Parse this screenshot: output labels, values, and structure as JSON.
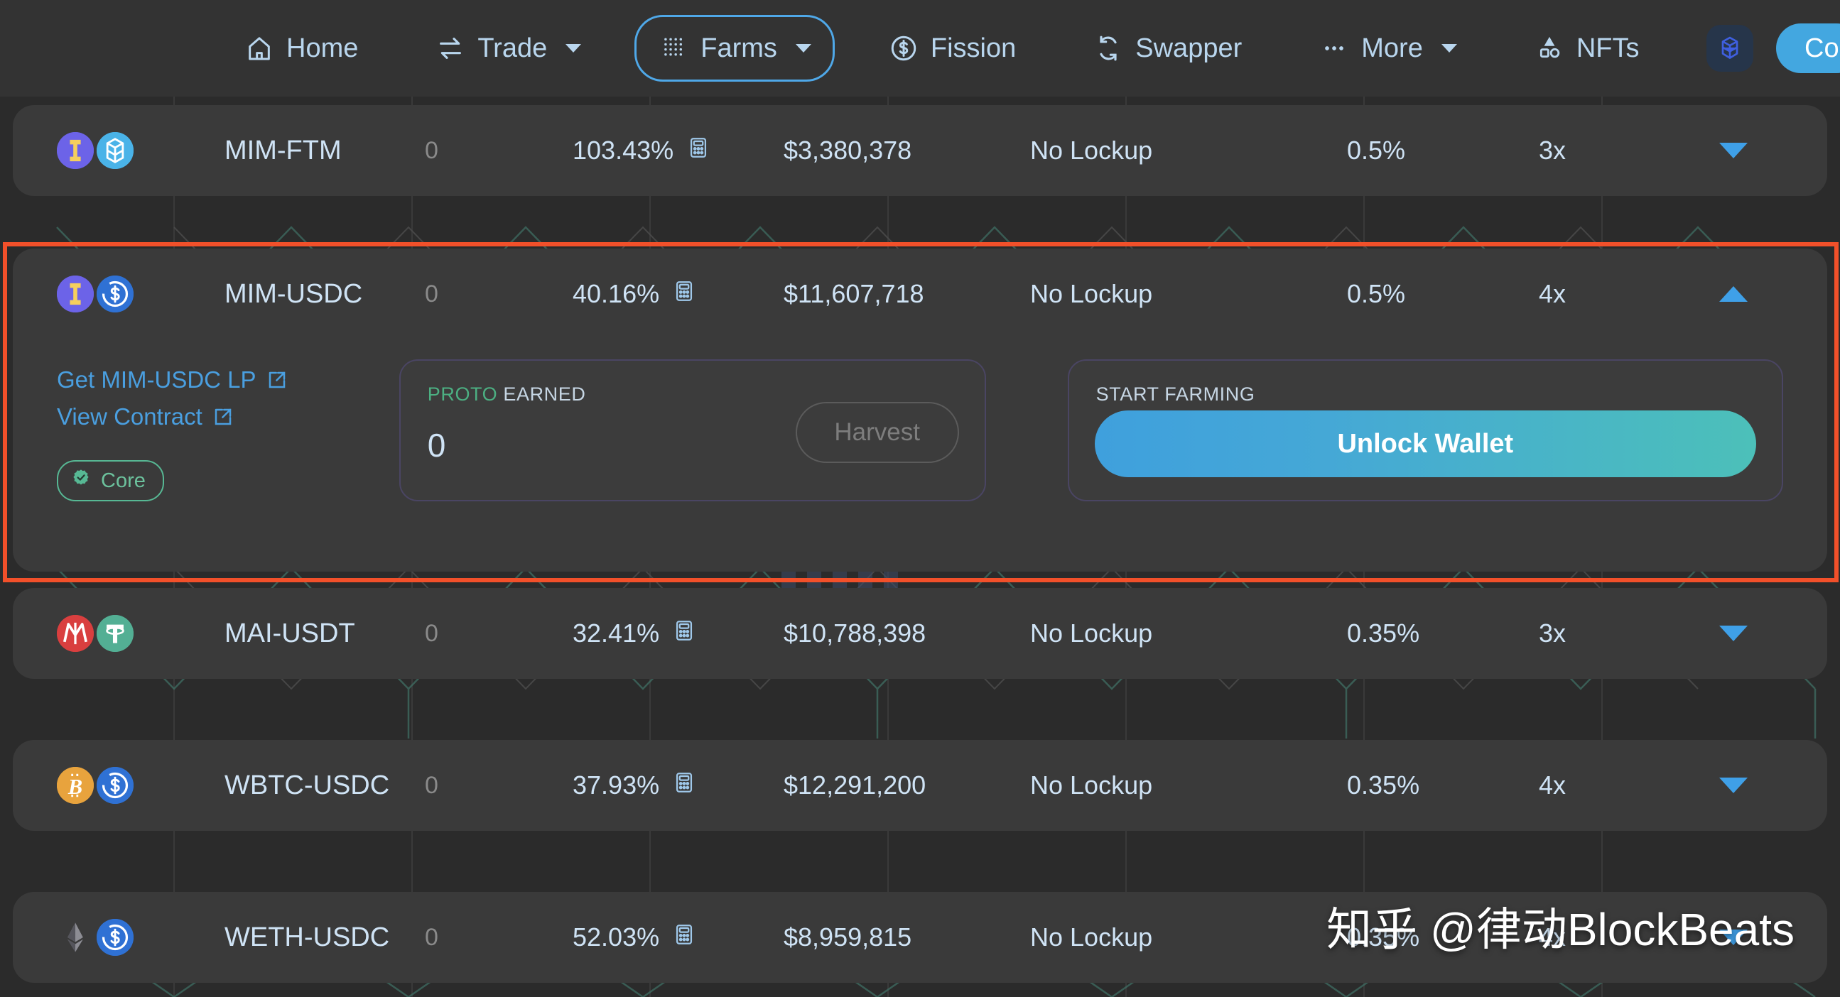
{
  "nav": {
    "items": [
      {
        "label": "Home",
        "icon": "home-icon",
        "has_caret": false,
        "active": false
      },
      {
        "label": "Trade",
        "icon": "swap-arrows-icon",
        "has_caret": true,
        "active": false
      },
      {
        "label": "Farms",
        "icon": "grid-dots-icon",
        "has_caret": true,
        "active": true
      },
      {
        "label": "Fission",
        "icon": "dollar-circle-icon",
        "has_caret": false,
        "active": false
      },
      {
        "label": "Swapper",
        "icon": "refresh-cycle-icon",
        "has_caret": false,
        "active": false
      },
      {
        "label": "More",
        "icon": "ellipsis-icon",
        "has_caret": true,
        "active": false
      },
      {
        "label": "NFTs",
        "icon": "shapes-icon",
        "has_caret": false,
        "active": false
      }
    ],
    "chain_badge_icon": "fantom-logo-icon",
    "connect_button_label": "Con",
    "accent_color": "#4fa8e8",
    "connect_button_color": "#43a7e0"
  },
  "farms": [
    {
      "pair": "MIM-FTM",
      "earned": "0",
      "apr": "103.43%",
      "liquidity": "$3,380,378",
      "lockup": "No Lockup",
      "fee": "0.5%",
      "multiplier": "3x",
      "expanded": false,
      "token_a": "mim-icon",
      "token_b": "fantom-icon",
      "chevron": "chevron-down-icon"
    },
    {
      "pair": "MIM-USDC",
      "earned": "0",
      "apr": "40.16%",
      "liquidity": "$11,607,718",
      "lockup": "No Lockup",
      "fee": "0.5%",
      "multiplier": "4x",
      "expanded": true,
      "token_a": "mim-icon",
      "token_b": "usdc-icon",
      "chevron": "chevron-up-icon",
      "detail": {
        "get_lp_label": "Get MIM-USDC LP",
        "view_contract_label": "View Contract",
        "core_badge_label": "Core",
        "core_badge_color": "#57b894",
        "earned_token": "PROTO",
        "earned_suffix": " EARNED",
        "earned_value": "0",
        "harvest_label": "Harvest",
        "harvest_disabled": true,
        "start_farming_label": "START FARMING",
        "unlock_label": "Unlock Wallet",
        "unlock_gradient_from": "#3fa0dd",
        "unlock_gradient_to": "#4cc0b9"
      }
    },
    {
      "pair": "MAI-USDT",
      "earned": "0",
      "apr": "32.41%",
      "liquidity": "$10,788,398",
      "lockup": "No Lockup",
      "fee": "0.35%",
      "multiplier": "3x",
      "expanded": false,
      "token_a": "mai-icon",
      "token_b": "usdt-icon",
      "chevron": "chevron-down-icon"
    },
    {
      "pair": "WBTC-USDC",
      "earned": "0",
      "apr": "37.93%",
      "liquidity": "$12,291,200",
      "lockup": "No Lockup",
      "fee": "0.35%",
      "multiplier": "4x",
      "expanded": false,
      "token_a": "wbtc-icon",
      "token_b": "usdc-icon",
      "chevron": "chevron-down-icon"
    },
    {
      "pair": "WETH-USDC",
      "earned": "0",
      "apr": "52.03%",
      "liquidity": "$8,959,815",
      "lockup": "No Lockup",
      "fee": "0.35%",
      "multiplier": "4x",
      "expanded": false,
      "token_a": "weth-icon",
      "token_b": "usdc-icon",
      "chevron": "chevron-down-icon"
    }
  ],
  "annotation": {
    "highlight_color": "#f2502a"
  },
  "watermarks": {
    "center_cjk": "律动",
    "center_latin": "BLOCKBEATS",
    "bottom": "知乎 @律动BlockBeats"
  }
}
